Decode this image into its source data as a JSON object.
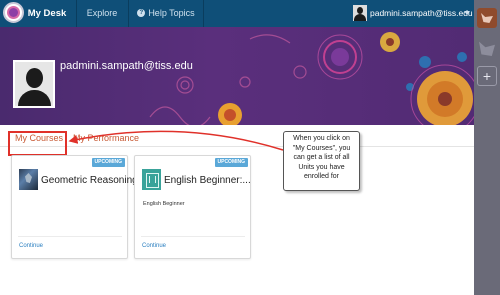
{
  "topnav": {
    "brand": "My Desk",
    "explore": "Explore",
    "help": "Help Topics",
    "help_icon_glyph": "?",
    "user_email": "padmini.sampath@tiss.edu"
  },
  "profile": {
    "name": "padmini.sampath@tiss.edu"
  },
  "tabs": [
    {
      "label": "My Courses",
      "active": true
    },
    {
      "label": "My Performance",
      "active": false
    }
  ],
  "courses": [
    {
      "title": "Geometric Reasoning",
      "subtitle": "",
      "badge": "UPCOMING",
      "action": "Continue",
      "icon": "geometry-thumbnail-icon"
    },
    {
      "title": "English Beginner:...",
      "subtitle": "English Beginner",
      "badge": "UPCOMING",
      "action": "Continue",
      "icon": "english-thumbnail-icon"
    }
  ],
  "callout": {
    "text": "When you click on \"My Courses\", you can get a list of all Units you have enrolled for"
  },
  "rail": {
    "plus_glyph": "+"
  },
  "colors": {
    "nav_bg": "#0f4f78",
    "banner_bg": "#5a2f7c",
    "tab_text": "#c85a35",
    "highlight": "#e0312a",
    "badge": "#5aa8d8",
    "link": "#2a7fc0",
    "rail_bg": "#6a6a78"
  }
}
